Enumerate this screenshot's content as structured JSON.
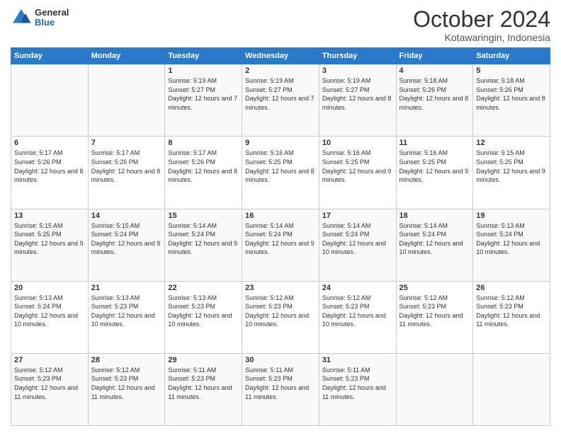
{
  "logo": {
    "general": "General",
    "blue": "Blue"
  },
  "header": {
    "month": "October 2024",
    "location": "Kotawaringin, Indonesia"
  },
  "days_of_week": [
    "Sunday",
    "Monday",
    "Tuesday",
    "Wednesday",
    "Thursday",
    "Friday",
    "Saturday"
  ],
  "weeks": [
    [
      {
        "day": "",
        "info": ""
      },
      {
        "day": "",
        "info": ""
      },
      {
        "day": "1",
        "info": "Sunrise: 5:19 AM\nSunset: 5:27 PM\nDaylight: 12 hours and 7 minutes."
      },
      {
        "day": "2",
        "info": "Sunrise: 5:19 AM\nSunset: 5:27 PM\nDaylight: 12 hours and 7 minutes."
      },
      {
        "day": "3",
        "info": "Sunrise: 5:19 AM\nSunset: 5:27 PM\nDaylight: 12 hours and 8 minutes."
      },
      {
        "day": "4",
        "info": "Sunrise: 5:18 AM\nSunset: 5:26 PM\nDaylight: 12 hours and 8 minutes."
      },
      {
        "day": "5",
        "info": "Sunrise: 5:18 AM\nSunset: 5:26 PM\nDaylight: 12 hours and 8 minutes."
      }
    ],
    [
      {
        "day": "6",
        "info": "Sunrise: 5:17 AM\nSunset: 5:26 PM\nDaylight: 12 hours and 8 minutes."
      },
      {
        "day": "7",
        "info": "Sunrise: 5:17 AM\nSunset: 5:26 PM\nDaylight: 12 hours and 8 minutes."
      },
      {
        "day": "8",
        "info": "Sunrise: 5:17 AM\nSunset: 5:26 PM\nDaylight: 12 hours and 8 minutes."
      },
      {
        "day": "9",
        "info": "Sunrise: 5:16 AM\nSunset: 5:25 PM\nDaylight: 12 hours and 8 minutes."
      },
      {
        "day": "10",
        "info": "Sunrise: 5:16 AM\nSunset: 5:25 PM\nDaylight: 12 hours and 9 minutes."
      },
      {
        "day": "11",
        "info": "Sunrise: 5:16 AM\nSunset: 5:25 PM\nDaylight: 12 hours and 9 minutes."
      },
      {
        "day": "12",
        "info": "Sunrise: 5:15 AM\nSunset: 5:25 PM\nDaylight: 12 hours and 9 minutes."
      }
    ],
    [
      {
        "day": "13",
        "info": "Sunrise: 5:15 AM\nSunset: 5:25 PM\nDaylight: 12 hours and 9 minutes."
      },
      {
        "day": "14",
        "info": "Sunrise: 5:15 AM\nSunset: 5:24 PM\nDaylight: 12 hours and 9 minutes."
      },
      {
        "day": "15",
        "info": "Sunrise: 5:14 AM\nSunset: 5:24 PM\nDaylight: 12 hours and 9 minutes."
      },
      {
        "day": "16",
        "info": "Sunrise: 5:14 AM\nSunset: 5:24 PM\nDaylight: 12 hours and 9 minutes."
      },
      {
        "day": "17",
        "info": "Sunrise: 5:14 AM\nSunset: 5:24 PM\nDaylight: 12 hours and 10 minutes."
      },
      {
        "day": "18",
        "info": "Sunrise: 5:14 AM\nSunset: 5:24 PM\nDaylight: 12 hours and 10 minutes."
      },
      {
        "day": "19",
        "info": "Sunrise: 5:13 AM\nSunset: 5:24 PM\nDaylight: 12 hours and 10 minutes."
      }
    ],
    [
      {
        "day": "20",
        "info": "Sunrise: 5:13 AM\nSunset: 5:24 PM\nDaylight: 12 hours and 10 minutes."
      },
      {
        "day": "21",
        "info": "Sunrise: 5:13 AM\nSunset: 5:23 PM\nDaylight: 12 hours and 10 minutes."
      },
      {
        "day": "22",
        "info": "Sunrise: 5:13 AM\nSunset: 5:23 PM\nDaylight: 12 hours and 10 minutes."
      },
      {
        "day": "23",
        "info": "Sunrise: 5:12 AM\nSunset: 5:23 PM\nDaylight: 12 hours and 10 minutes."
      },
      {
        "day": "24",
        "info": "Sunrise: 5:12 AM\nSunset: 5:23 PM\nDaylight: 12 hours and 10 minutes."
      },
      {
        "day": "25",
        "info": "Sunrise: 5:12 AM\nSunset: 5:23 PM\nDaylight: 12 hours and 11 minutes."
      },
      {
        "day": "26",
        "info": "Sunrise: 5:12 AM\nSunset: 5:23 PM\nDaylight: 12 hours and 11 minutes."
      }
    ],
    [
      {
        "day": "27",
        "info": "Sunrise: 5:12 AM\nSunset: 5:23 PM\nDaylight: 12 hours and 11 minutes."
      },
      {
        "day": "28",
        "info": "Sunrise: 5:12 AM\nSunset: 5:23 PM\nDaylight: 12 hours and 11 minutes."
      },
      {
        "day": "29",
        "info": "Sunrise: 5:11 AM\nSunset: 5:23 PM\nDaylight: 12 hours and 11 minutes."
      },
      {
        "day": "30",
        "info": "Sunrise: 5:11 AM\nSunset: 5:23 PM\nDaylight: 12 hours and 11 minutes."
      },
      {
        "day": "31",
        "info": "Sunrise: 5:11 AM\nSunset: 5:23 PM\nDaylight: 12 hours and 11 minutes."
      },
      {
        "day": "",
        "info": ""
      },
      {
        "day": "",
        "info": ""
      }
    ]
  ]
}
